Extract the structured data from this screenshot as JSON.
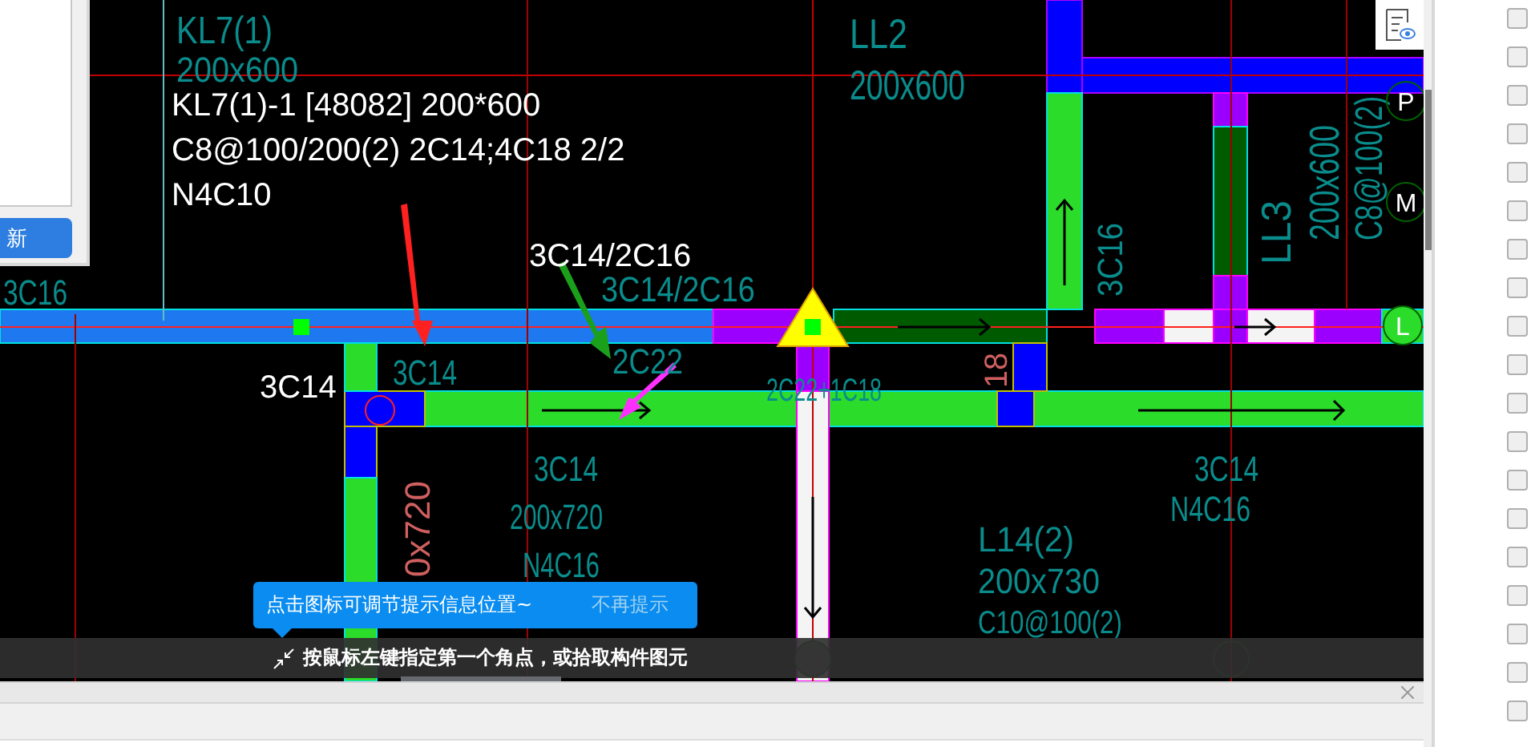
{
  "dialog": {
    "button": "新"
  },
  "cad_labels": [
    {
      "text": "KL7(1)",
      "color": "#0a8c8c"
    },
    {
      "text": "200x600",
      "color": "#0a8c8c"
    },
    {
      "text": "3C16",
      "color": "#0a8c8c"
    },
    {
      "text": "3C14/2C16",
      "color": "#0a8c8c"
    },
    {
      "text": "3C14",
      "color": "#0a8c8c"
    },
    {
      "text": "2C22",
      "color": "#0a8c8c"
    },
    {
      "text": "LL2",
      "color": "#0a8c8c"
    },
    {
      "text": "200x600",
      "color": "#0a8c8c"
    },
    {
      "text": "3C16",
      "color": "#0a8c8c"
    },
    {
      "text": "LL3",
      "color": "#0a8c8c"
    },
    {
      "text": "200x600",
      "color": "#0a8c8c"
    },
    {
      "text": "C8@100(2)",
      "color": "#0a8c8c"
    },
    {
      "text": "2C22+1C18",
      "color": "#0a8c8c"
    },
    {
      "text": "18",
      "color": "#d06060"
    },
    {
      "text": "3C14",
      "color": "#0a8c8c"
    },
    {
      "text": "200x720",
      "color": "#0a8c8c"
    },
    {
      "text": "N4C16",
      "color": "#0a8c8c"
    },
    {
      "text": "0x720",
      "color": "#d06060"
    },
    {
      "text": "L14(2)",
      "color": "#0a8c8c"
    },
    {
      "text": "200x730",
      "color": "#0a8c8c"
    },
    {
      "text": "C10@100(2)",
      "color": "#0a8c8c"
    },
    {
      "text": "3C14",
      "color": "#0a8c8c"
    },
    {
      "text": "N4C16",
      "color": "#0a8c8c"
    }
  ],
  "annotations": [
    "KL7(1)-1 [48082] 200*600",
    "C8@100/200(2) 2C14;4C18 2/2",
    "N4C10",
    "3C14/2C16",
    "3C14"
  ],
  "axis_markers": [
    "P",
    "M",
    "L"
  ],
  "tooltip": {
    "text": "点击图标可调节提示信息位置~",
    "dismiss": "不再提示"
  },
  "status": "按鼠标左键指定第一个角点，或拾取构件图元",
  "checkboxes": [
    {
      "checked": false
    },
    {
      "checked": false
    },
    {
      "checked": false
    },
    {
      "checked": false
    },
    {
      "checked": false
    },
    {
      "checked": false
    },
    {
      "checked": false
    },
    {
      "checked": false
    },
    {
      "checked": false
    },
    {
      "checked": false
    },
    {
      "checked": false
    },
    {
      "checked": false
    },
    {
      "checked": false
    },
    {
      "checked": false
    },
    {
      "checked": false
    },
    {
      "checked": false
    },
    {
      "checked": false
    },
    {
      "checked": false
    },
    {
      "checked": false
    }
  ]
}
